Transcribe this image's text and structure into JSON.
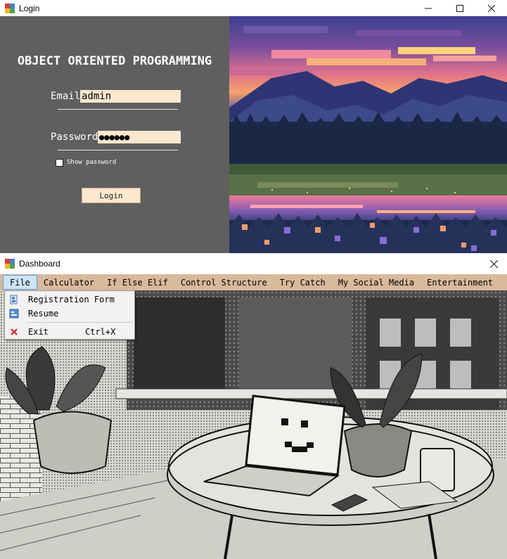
{
  "login": {
    "window_title": "Login",
    "heading": "OBJECT ORIENTED PROGRAMMING",
    "email_label": "Email",
    "email_value": "admin",
    "password_label": "Password",
    "password_value": "●●●●●●",
    "show_password_label": "Show password",
    "show_password_checked": false,
    "login_button_label": "Login",
    "minimize_icon": "minimize-icon",
    "maximize_icon": "maximize-icon",
    "close_icon": "close-icon"
  },
  "dashboard": {
    "window_title": "Dashboard",
    "close_icon": "close-icon",
    "menu": [
      {
        "label": "File"
      },
      {
        "label": "Calculator"
      },
      {
        "label": "If Else Elif"
      },
      {
        "label": "Control Structure"
      },
      {
        "label": "Try Catch"
      },
      {
        "label": "My Social Media"
      },
      {
        "label": "Entertainment"
      }
    ],
    "file_menu": {
      "items": [
        {
          "label": "Registration Form",
          "icon": "form-icon"
        },
        {
          "label": "Resume",
          "icon": "document-icon"
        },
        {
          "label": "Exit",
          "icon": "exit-x-icon",
          "shortcut": "Ctrl+X"
        }
      ]
    }
  },
  "colors": {
    "login_panel": "#5f5f5f",
    "input_bg": "#fde7cf",
    "menubar": "#d9b99b",
    "menu_active": "#cde4f7"
  }
}
